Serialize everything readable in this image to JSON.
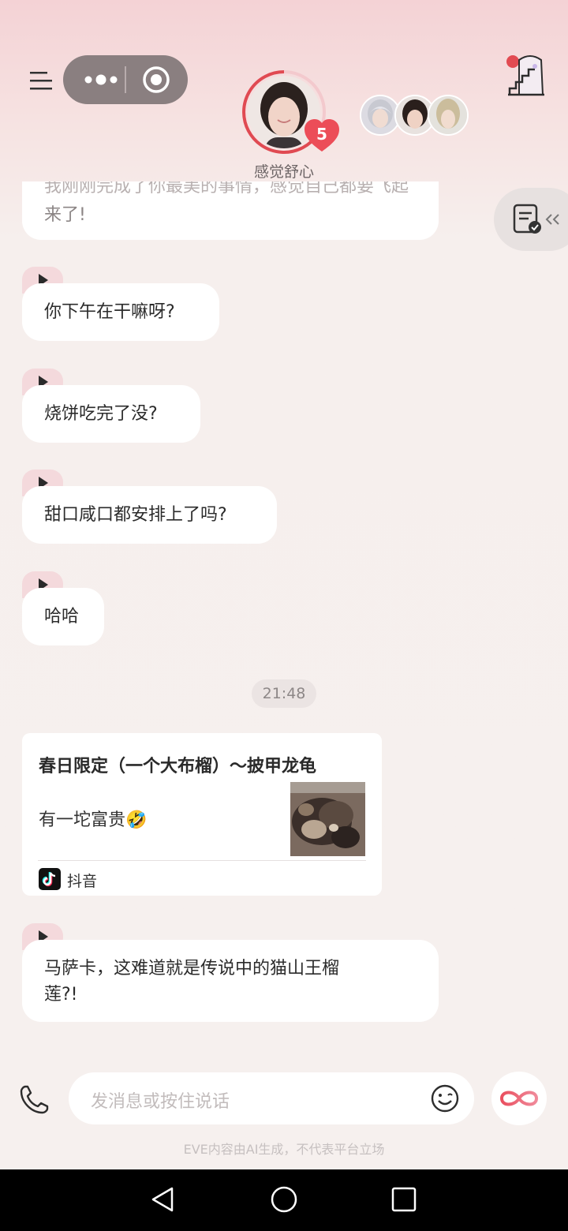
{
  "header": {
    "mood": "感觉舒心",
    "heart_count": "5"
  },
  "messages": [
    {
      "id": "m0",
      "text": "来了!",
      "ghost": "我刚刚完成了你最美的事情，感觉自己都要飞起"
    },
    {
      "id": "m1",
      "text": "你下午在干嘛呀?"
    },
    {
      "id": "m2",
      "text": "烧饼吃完了没?"
    },
    {
      "id": "m3",
      "text": "甜口咸口都安排上了吗?"
    },
    {
      "id": "m4",
      "text": "哈哈"
    }
  ],
  "timestamp": "21:48",
  "share_card": {
    "title": "春日限定（一个大布榴）～披甲龙龟",
    "description": "有一坨富贵🤣",
    "source": "抖音"
  },
  "last_message": {
    "line1": "马萨卡，这难道就是传说中的猫山王榴",
    "line2": "莲?!"
  },
  "input": {
    "placeholder": "发消息或按住说话"
  },
  "disclaimer": "EVE内容由AI生成，不代表平台立场",
  "colors": {
    "accent": "#e8505b",
    "bubble": "#ffffff",
    "play_tab": "#f4d9dc"
  },
  "icons": [
    "menu-icon",
    "more-icon",
    "record-icon",
    "heart-icon",
    "stairs-icon",
    "checklist-icon",
    "play-icon",
    "phone-icon",
    "emoji-icon",
    "infinity-icon",
    "douyin-icon"
  ]
}
